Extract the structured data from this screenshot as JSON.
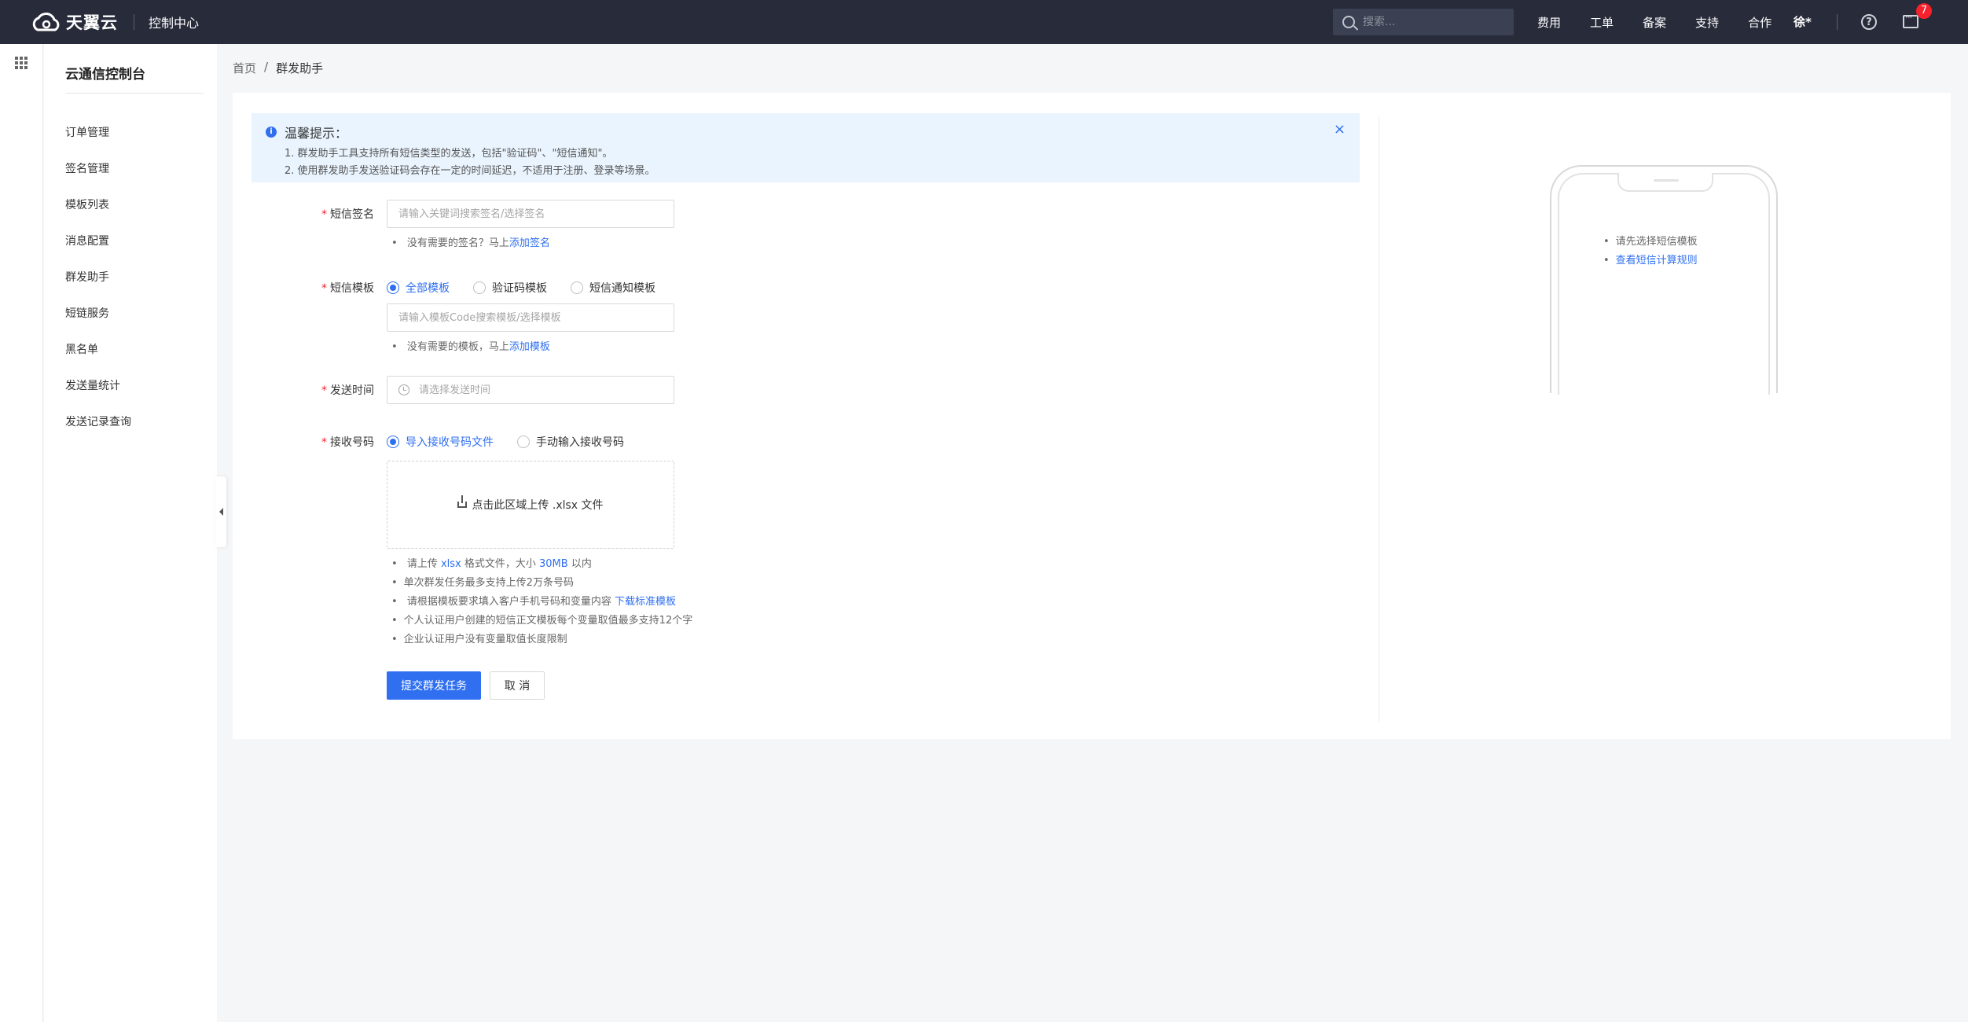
{
  "topbar": {
    "brand": "天翼云",
    "console_title": "控制中心",
    "search_placeholder": "搜索...",
    "nav": [
      "费用",
      "工单",
      "备案",
      "支持",
      "合作"
    ],
    "user": "徐*",
    "help_glyph": "?",
    "notification_count": "7"
  },
  "sidebar": {
    "title": "云通信控制台",
    "items": [
      "订单管理",
      "签名管理",
      "模板列表",
      "消息配置",
      "群发助手",
      "短链服务",
      "黑名单",
      "发送量统计",
      "发送记录查询"
    ]
  },
  "breadcrumb": {
    "home": "首页",
    "separator": "/",
    "current": "群发助手"
  },
  "alert": {
    "title": "温馨提示：",
    "line1": "1. 群发助手工具支持所有短信类型的发送，包括\"验证码\"、\"短信通知\"。",
    "line2": "2. 使用群发助手发送验证码会存在一定的时间延迟，不适用于注册、登录等场景。",
    "close": "×"
  },
  "form": {
    "signature": {
      "label": "短信签名",
      "placeholder": "请输入关键词搜索签名/选择签名",
      "hint_prefix": "没有需要的签名？马上",
      "hint_link": "添加签名"
    },
    "template": {
      "label": "短信模板",
      "options": [
        "全部模板",
        "验证码模板",
        "短信通知模板"
      ],
      "selected": "全部模板",
      "placeholder": "请输入模板Code搜索模板/选择模板",
      "hint_prefix": "没有需要的模板，马上",
      "hint_link": "添加模板"
    },
    "send_time": {
      "label": "发送时间",
      "placeholder": "请选择发送时间"
    },
    "numbers": {
      "label": "接收号码",
      "options": [
        "导入接收号码文件",
        "手动输入接收号码"
      ],
      "selected": "导入接收号码文件",
      "upload_text": "点击此区域上传 .xlsx 文件",
      "hint1_a": "请上传 ",
      "hint1_link1": "xlsx",
      "hint1_b": " 格式文件，大小 ",
      "hint1_link2": "30MB",
      "hint1_c": " 以内",
      "hint2": "单次群发任务最多支持上传2万条号码",
      "hint3_prefix": "请根据模板要求填入客户手机号码和变量内容 ",
      "hint3_link": "下载标准模板",
      "hint4": "个人认证用户创建的短信正文模板每个变量取值最多支持12个字",
      "hint5": "企业认证用户没有变量取值长度限制"
    },
    "required_mark": "*",
    "submit": "提交群发任务",
    "cancel": "取 消"
  },
  "preview": {
    "tip1": "请先选择短信模板",
    "tip2": "查看短信计算规则"
  },
  "colors": {
    "primary": "#2f6ff0",
    "topbar": "#272b3a",
    "badge": "#f5222d"
  }
}
